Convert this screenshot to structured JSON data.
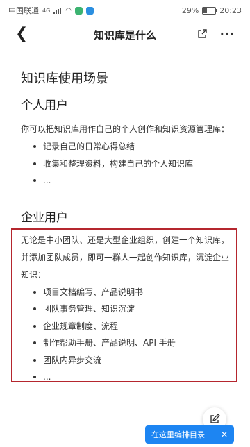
{
  "status_bar": {
    "carrier": "中国联通",
    "network": "4G",
    "battery": "29%",
    "battery_level": 0.29,
    "time": "20:23"
  },
  "nav": {
    "back_icon": "chevron-left-icon",
    "title": "知识库是什么",
    "share_icon": "share-icon",
    "more_label": "···"
  },
  "article": {
    "heading": "知识库使用场景",
    "personal": {
      "title": "个人用户",
      "intro": "你可以把知识库用作自己的个人创作和知识资源管理库：",
      "items": [
        "记录自己的日常心得总结",
        "收集和整理资料，构建自己的个人知识库",
        "..."
      ]
    },
    "enterprise": {
      "title": "企业用户",
      "intro": "无论是中小团队、还是大型企业组织，创建一个知识库，并添加团队成员，即可一群人一起创作知识库，沉淀企业知识：",
      "items": [
        "项目文档编写、产品说明书",
        "团队事务管理、知识沉淀",
        "企业规章制度、流程",
        "制作帮助手册、产品说明、API 手册",
        "团队内异步交流",
        "..."
      ]
    }
  },
  "toast": {
    "label": "在这里编排目录",
    "close_label": "✕"
  },
  "colors": {
    "highlight_border": "#b5262e",
    "toast_bg": "#1d85f2"
  }
}
